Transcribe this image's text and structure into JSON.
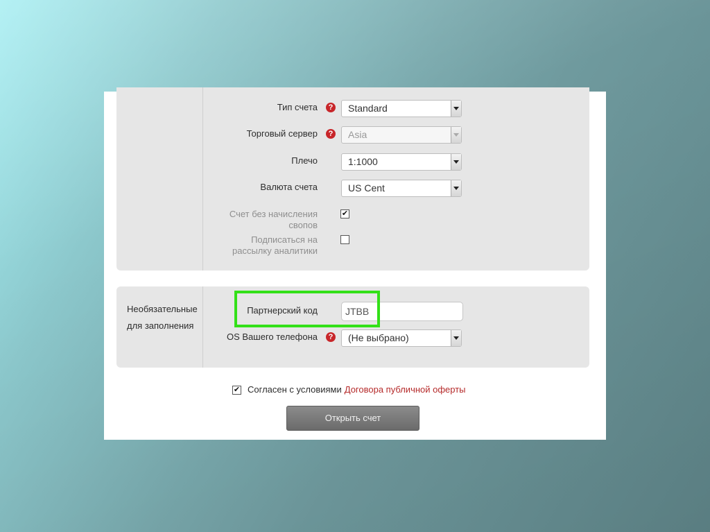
{
  "form": {
    "account_type": {
      "label": "Тип счета",
      "value": "Standard"
    },
    "trade_server": {
      "label": "Торговый сервер",
      "value": "Asia"
    },
    "leverage": {
      "label": "Плечо",
      "value": "1:1000"
    },
    "currency": {
      "label": "Валюта счета",
      "value": "US Cent"
    },
    "swap_free": {
      "label_line1": "Счет без начисления",
      "label_line2": "свопов",
      "checked": true
    },
    "subscribe": {
      "label_line1": "Подписаться на",
      "label_line2": "рассылку аналитики",
      "checked": false
    },
    "help_glyph": "?",
    "check_glyph": "✔"
  },
  "optional": {
    "title_line1": "Необязательные",
    "title_line2": "для заполнения",
    "partner_code": {
      "label": "Партнерский код",
      "value": "JTBB"
    },
    "phone_os": {
      "label": "OS Вашего телефона",
      "value": "(Не выбрано)"
    }
  },
  "consent": {
    "text": "Согласен с условиями",
    "link": "Договора публичной оферты",
    "checked": true
  },
  "submit_label": "Открыть счет",
  "colors": {
    "highlight": "#33e018",
    "help_icon": "#c8262a",
    "link": "#b52a2a",
    "button": "#7b7b7b"
  }
}
